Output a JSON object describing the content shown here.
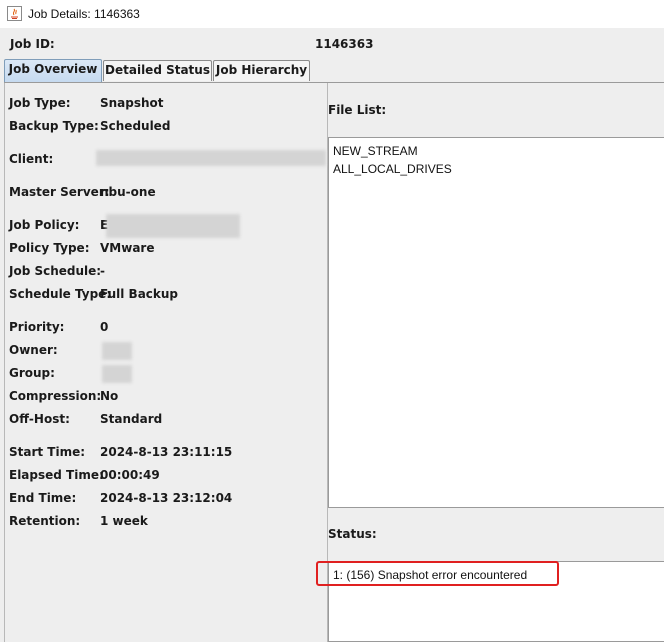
{
  "window": {
    "title": "Job Details: 1146363"
  },
  "job": {
    "id_label": "Job ID:",
    "id_value": "1146363"
  },
  "tabs": [
    {
      "label": "Job Overview",
      "active": true
    },
    {
      "label": "Detailed Status",
      "active": false
    },
    {
      "label": "Job Hierarchy",
      "active": false
    }
  ],
  "overview": {
    "job_type": {
      "label": "Job Type:",
      "value": "Snapshot"
    },
    "backup_type": {
      "label": "Backup Type:",
      "value": "Scheduled"
    },
    "client": {
      "label": "Client:",
      "value": ""
    },
    "master_server": {
      "label": "Master Server:",
      "value": "nbu-one"
    },
    "job_policy": {
      "label": "Job Policy:",
      "value": "E"
    },
    "policy_type": {
      "label": "Policy Type:",
      "value": "VMware"
    },
    "job_schedule": {
      "label": "Job Schedule:",
      "value": "-"
    },
    "schedule_type": {
      "label": "Schedule Type:",
      "value": "Full Backup"
    },
    "priority": {
      "label": "Priority:",
      "value": "0"
    },
    "owner": {
      "label": "Owner:",
      "value": ""
    },
    "group": {
      "label": "Group:",
      "value": ""
    },
    "compression": {
      "label": "Compression:",
      "value": "No"
    },
    "off_host": {
      "label": "Off-Host:",
      "value": "Standard"
    },
    "start_time": {
      "label": "Start Time:",
      "value": "2024-8-13 23:11:15"
    },
    "elapsed_time": {
      "label": "Elapsed Time:",
      "value": "00:00:49"
    },
    "end_time": {
      "label": "End Time:",
      "value": "2024-8-13 23:12:04"
    },
    "retention": {
      "label": "Retention:",
      "value": "1 week"
    }
  },
  "file_list": {
    "label": "File List:",
    "items": [
      "NEW_STREAM",
      "ALL_LOCAL_DRIVES"
    ]
  },
  "status": {
    "label": "Status:",
    "items": [
      "1: (156) Snapshot error encountered"
    ]
  },
  "colors": {
    "highlight": "#e02020",
    "active_tab": "#c6daf0"
  }
}
